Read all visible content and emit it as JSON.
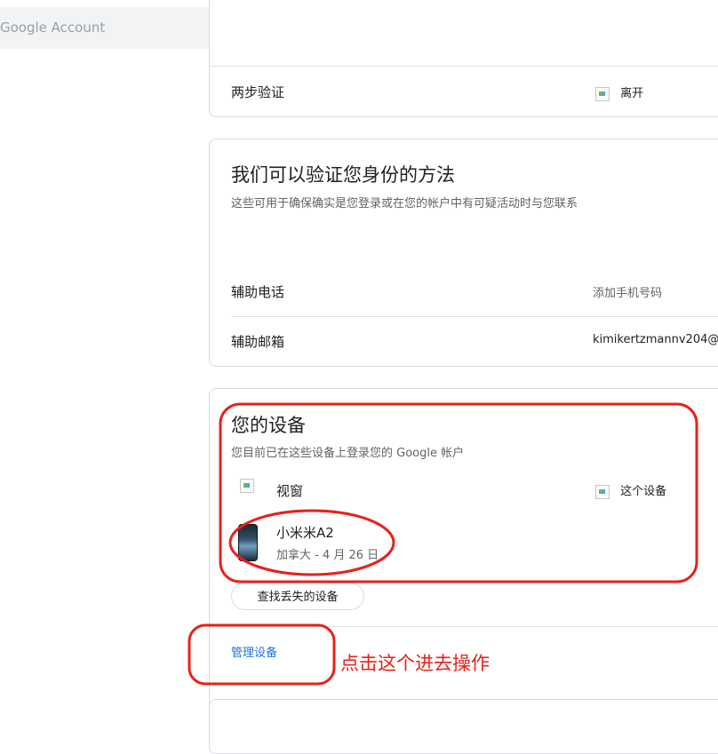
{
  "search": {
    "placeholder": "Google Account"
  },
  "faded_status": "离开",
  "two_step": {
    "label": "两步验证",
    "status": "离开"
  },
  "verify": {
    "title": "我们可以验证您身份的方法",
    "subtitle": "这些可用于确保确实是您登录或在您的帐户中有可疑活动时与您联系",
    "rows": [
      {
        "label": "辅助电话",
        "value": "添加手机号码"
      },
      {
        "label": "辅助邮箱",
        "value": "kimikertzmannv204@"
      }
    ]
  },
  "devices": {
    "title": "您的设备",
    "subtitle": "您目前已在这些设备上登录您的 Google 帐户",
    "items": [
      {
        "name": "视窗",
        "status": "这个设备"
      },
      {
        "name": "小米米A2",
        "detail": "加拿大 - 4 月 26 日"
      }
    ],
    "find_button": "查找丢失的设备",
    "manage_link": "管理设备"
  },
  "annotation": {
    "text": "点击这个进去操作",
    "color": "#e8201a"
  },
  "colors": {
    "link": "#1a73e8",
    "annotation": "#e8201a"
  }
}
